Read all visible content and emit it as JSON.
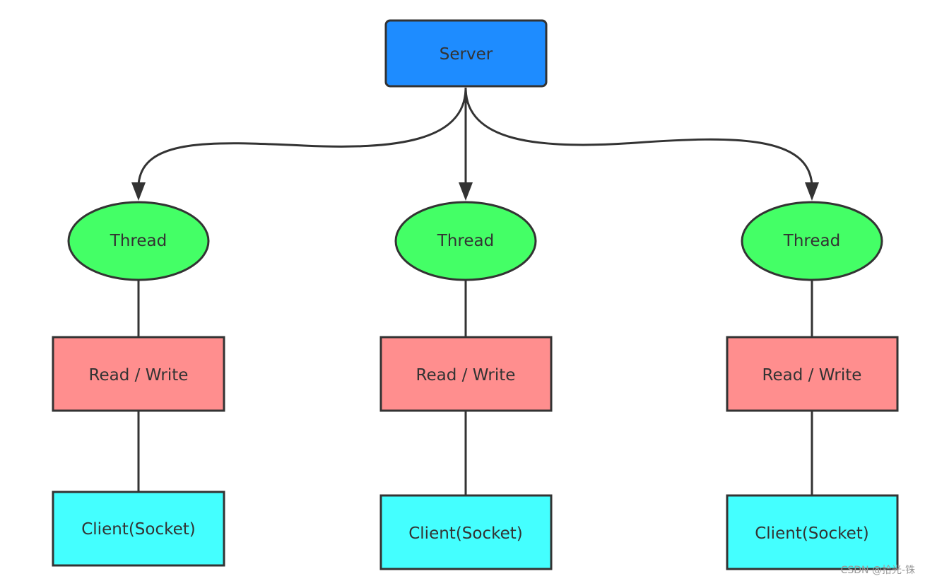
{
  "server": {
    "label": "Server",
    "color": "#1e8cff"
  },
  "columns": [
    {
      "thread": "Thread",
      "rw": "Read / Write",
      "client": "Client(Socket)"
    },
    {
      "thread": "Thread",
      "rw": "Read / Write",
      "client": "Client(Socket)"
    },
    {
      "thread": "Thread",
      "rw": "Read / Write",
      "client": "Client(Socket)"
    }
  ],
  "colors": {
    "thread": "#44ff66",
    "rw": "#ff8e8e",
    "client": "#44ffff",
    "stroke": "#333333"
  },
  "watermark": "CSDN @拾光-铢"
}
